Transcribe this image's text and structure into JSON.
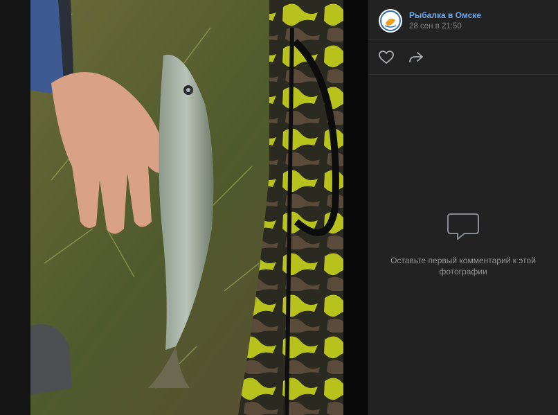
{
  "post": {
    "author": "Рыбалка в Омске",
    "date": "28 сен в 21:50"
  },
  "actions": {
    "like_icon": "heart-icon",
    "share_icon": "share-arrow-icon"
  },
  "comments": {
    "empty_icon": "comment-bubble-icon",
    "empty_text": "Оставьте первый комментарий к этой фотографии"
  },
  "colors": {
    "link": "#71aaeb",
    "panel_bg": "#222222",
    "muted": "#828282"
  }
}
